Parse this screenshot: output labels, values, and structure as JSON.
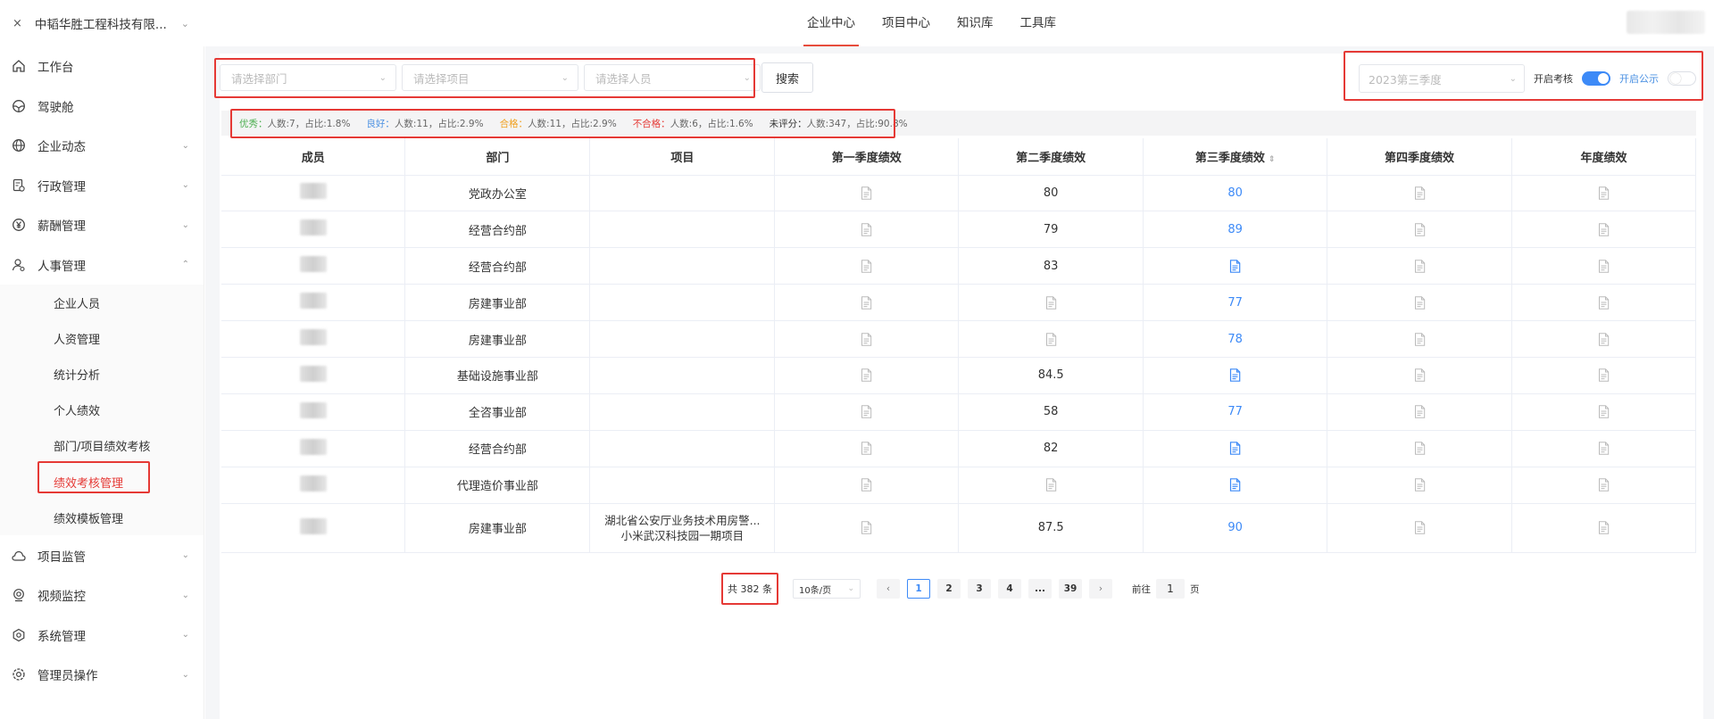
{
  "header": {
    "close_icon": "×",
    "company": "中韬华胜工程科技有限...",
    "tabs": [
      {
        "label": "企业中心",
        "active": true
      },
      {
        "label": "项目中心",
        "active": false
      },
      {
        "label": "知识库",
        "active": false
      },
      {
        "label": "工具库",
        "active": false
      }
    ]
  },
  "sidebar": {
    "items": [
      {
        "label": "工作台",
        "icon": "home-icon"
      },
      {
        "label": "驾驶舱",
        "icon": "steering-wheel-icon"
      },
      {
        "label": "企业动态",
        "icon": "globe-icon",
        "arrow": "⌄"
      },
      {
        "label": "行政管理",
        "icon": "document-settings-icon",
        "arrow": "⌄"
      },
      {
        "label": "薪酬管理",
        "icon": "yen-icon",
        "arrow": "⌄"
      },
      {
        "label": "人事管理",
        "icon": "user-settings-icon",
        "arrow": "⌃"
      }
    ],
    "subitems": [
      {
        "label": "企业人员"
      },
      {
        "label": "人资管理"
      },
      {
        "label": "统计分析"
      },
      {
        "label": "个人绩效"
      },
      {
        "label": "部门/项目绩效考核"
      },
      {
        "label": "绩效考核管理",
        "active": true
      },
      {
        "label": "绩效模板管理"
      }
    ],
    "bottom_items": [
      {
        "label": "项目监管",
        "icon": "cloud-icon",
        "arrow": "⌄"
      },
      {
        "label": "视频监控",
        "icon": "camera-icon",
        "arrow": "⌄"
      },
      {
        "label": "系统管理",
        "icon": "hexagon-settings-icon",
        "arrow": "⌄"
      },
      {
        "label": "管理员操作",
        "icon": "admin-gear-icon",
        "arrow": "⌄"
      }
    ]
  },
  "filters": {
    "department_placeholder": "请选择部门",
    "project_placeholder": "请选择项目",
    "person_placeholder": "请选择人员",
    "search_label": "搜索"
  },
  "controls": {
    "quarter_placeholder": "2023第三季度",
    "toggle1_label": "开启考核",
    "toggle1_on": true,
    "toggle2_label": "开启公示",
    "toggle2_on": false
  },
  "stats": [
    {
      "label": "优秀：",
      "text": "人数:7，占比:1.8%",
      "color": "green"
    },
    {
      "label": "良好：",
      "text": "人数:11，占比:2.9%",
      "color": "blue"
    },
    {
      "label": "合格：",
      "text": "人数:11，占比:2.9%",
      "color": "orange"
    },
    {
      "label": "不合格：",
      "text": "人数:6，占比:1.6%",
      "color": "red"
    },
    {
      "label": "未评分：",
      "text": "人数:347，占比:90.8%",
      "color": "dark"
    }
  ],
  "table": {
    "headers": [
      "成员",
      "部门",
      "项目",
      "第一季度绩效",
      "第二季度绩效",
      "第三季度绩效",
      "第四季度绩效",
      "年度绩效"
    ],
    "sort_icon": "⇕",
    "rows": [
      {
        "dept": "党政办公室",
        "project": "",
        "q1": "",
        "q2": "80",
        "q3": "80",
        "q4": "",
        "year": ""
      },
      {
        "dept": "经营合约部",
        "project": "",
        "q1": "",
        "q2": "79",
        "q3": "89",
        "q4": "",
        "year": ""
      },
      {
        "dept": "经营合约部",
        "project": "",
        "q1": "",
        "q2": "83",
        "q3": "",
        "q4": "",
        "year": ""
      },
      {
        "dept": "房建事业部",
        "project": "",
        "q1": "",
        "q2": "",
        "q3": "77",
        "q4": "",
        "year": ""
      },
      {
        "dept": "房建事业部",
        "project": "",
        "q1": "",
        "q2": "",
        "q3": "78",
        "q4": "",
        "year": ""
      },
      {
        "dept": "基础设施事业部",
        "project": "",
        "q1": "",
        "q2": "84.5",
        "q3": "",
        "q4": "",
        "year": ""
      },
      {
        "dept": "全咨事业部",
        "project": "",
        "q1": "",
        "q2": "58",
        "q3": "77",
        "q4": "",
        "year": ""
      },
      {
        "dept": "经营合约部",
        "project": "",
        "q1": "",
        "q2": "82",
        "q3": "",
        "q4": "",
        "year": ""
      },
      {
        "dept": "代理造价事业部",
        "project": "",
        "q1": "",
        "q2": "",
        "q3": "",
        "q4": "",
        "year": ""
      },
      {
        "dept": "房建事业部",
        "project": "湖北省公安厅业务技术用房警...\n小米武汉科技园一期项目",
        "project_line1": "湖北省公安厅业务技术用房警...",
        "project_line2": "小米武汉科技园一期项目",
        "q1": "",
        "q2": "87.5",
        "q3": "90",
        "q4": "",
        "year": ""
      }
    ]
  },
  "pagination": {
    "total": "共 382 条",
    "page_size": "10条/页",
    "prev": "‹",
    "pages": [
      "1",
      "2",
      "3",
      "4",
      "...",
      "39"
    ],
    "next": "›",
    "goto_label": "前往",
    "goto_value": "1",
    "goto_suffix": "页"
  }
}
